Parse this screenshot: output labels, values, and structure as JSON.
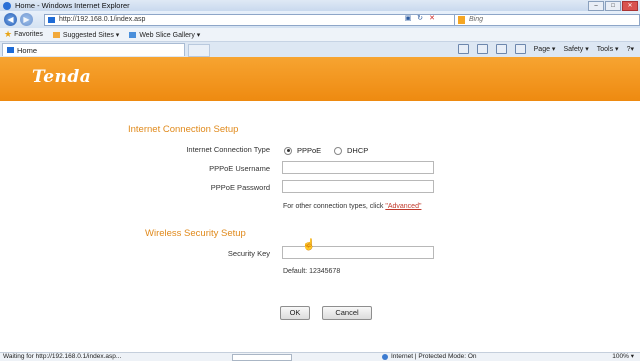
{
  "window": {
    "title": "Home - Windows Internet Explorer"
  },
  "address_bar": {
    "url": "http://192.168.0.1/index.asp",
    "search_placeholder": "Bing"
  },
  "favorites_bar": {
    "favorites_label": "Favorites",
    "items": [
      "Suggested Sites ▾",
      "Web Slice Gallery ▾"
    ]
  },
  "tab": {
    "label": "Home"
  },
  "command_bar": {
    "page": "Page ▾",
    "safety": "Safety ▾",
    "tools": "Tools ▾",
    "help": "?▾"
  },
  "page": {
    "logo": "Tenda",
    "internet_section": {
      "title": "Internet Connection Setup",
      "type_label": "Internet Connection Type",
      "options": [
        "PPPoE",
        "DHCP"
      ],
      "selected": "PPPoE",
      "username_label": "PPPoE Username",
      "username_value": "",
      "password_label": "PPPoE Password",
      "password_value": "",
      "hint_text": "For other connection types, click",
      "advanced_link": "\"Advanced\""
    },
    "wireless_section": {
      "title": "Wireless Security Setup",
      "key_label": "Security Key",
      "key_value": "",
      "default_text": "Default: 12345678"
    },
    "buttons": {
      "ok": "OK",
      "cancel": "Cancel"
    }
  },
  "status_bar": {
    "status_text": "Waiting for http://192.168.0.1/index.asp...",
    "zone": "Internet | Protected Mode: On",
    "zoom": "100% ▾"
  }
}
